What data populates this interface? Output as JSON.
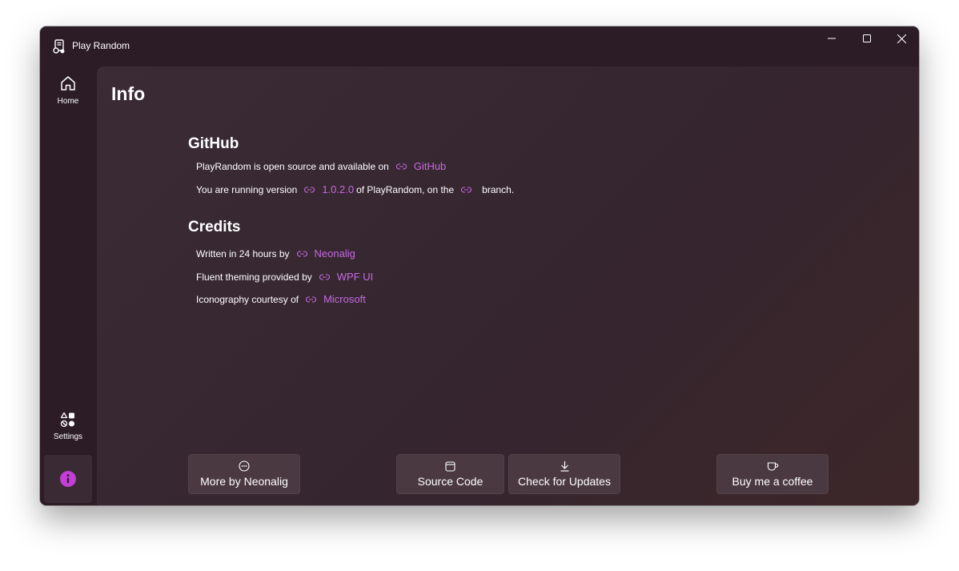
{
  "window": {
    "title": "Play Random"
  },
  "sidebar": {
    "items": [
      {
        "label": "Home",
        "icon": "home-icon"
      },
      {
        "label": "Settings",
        "icon": "settings-shapes-icon"
      },
      {
        "label": "",
        "icon": "info-icon",
        "active": true
      }
    ]
  },
  "page": {
    "title": "Info"
  },
  "github": {
    "title": "GitHub",
    "open_source_text": "PlayRandom is open source and available on",
    "github_link": "GitHub",
    "version_prefix": "You are running version",
    "version_link": "1.0.2.0",
    "version_middle": "of PlayRandom, on the",
    "branch_link": "",
    "version_suffix": "branch."
  },
  "credits": {
    "title": "Credits",
    "written_text": "Written in 24 hours by",
    "written_link": "Neonalig",
    "theming_text": "Fluent theming provided by",
    "theming_link": "WPF UI",
    "icons_text": "Iconography courtesy of",
    "icons_link": "Microsoft"
  },
  "buttons": {
    "more": "More by Neonalig",
    "source": "Source Code",
    "updates": "Check for Updates",
    "coffee": "Buy me a coffee"
  },
  "colors": {
    "accent": "#c23ed6",
    "link": "#c66ae0",
    "window_bg": "#2c1c25",
    "content_bg": "#3a2b35"
  }
}
